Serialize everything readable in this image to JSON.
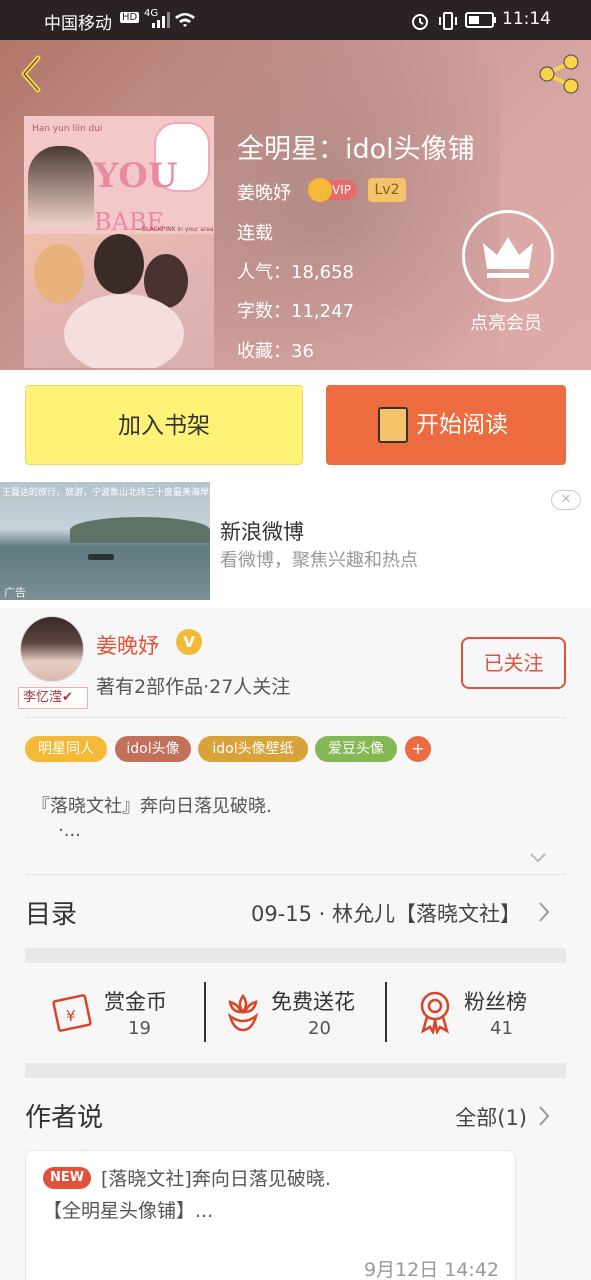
{
  "status_bar": {
    "carrier": "中国移动",
    "network": "4G",
    "time": "11:14"
  },
  "book": {
    "title": "全明星：idol头像铺",
    "author": "姜晚妤",
    "vip_label": "VIP",
    "level": "Lv2",
    "status": "连载",
    "popularity": "人气：18,658",
    "word_count": "字数：11,247",
    "favorites": "收藏：36",
    "cover_text": {
      "top": "Han yun liin dui",
      "you": "YOU",
      "babe": "BABE",
      "tagline": "—BLACKPINK in your area"
    }
  },
  "member": {
    "label": "点亮会员"
  },
  "actions": {
    "add_shelf": "加入书架",
    "start_read": "开始阅读"
  },
  "ad": {
    "caption": "王曼达的旅行，旅游，宁波象山北纬三十度最美海岸线，这",
    "title": "新浪微博",
    "subtitle": "看微博，聚焦兴趣和热点",
    "ad_label": "广告",
    "close": "✕"
  },
  "author_card": {
    "name": "姜晚妤",
    "verified": "V",
    "stats": "著有2部作品·27人关注",
    "avatar_tag": "李忆滢✔",
    "follow_label": "已关注"
  },
  "tags": [
    {
      "label": "明星同人",
      "color": "#f5b938"
    },
    {
      "label": "idol头像",
      "color": "#c2705a"
    },
    {
      "label": "idol头像壁纸",
      "color": "#d8a33a"
    },
    {
      "label": "爱豆头像",
      "color": "#85b855"
    }
  ],
  "tag_add": "+",
  "description": {
    "line1": "『落晓文社』奔向日落见破晓.",
    "line2": "·..."
  },
  "toc": {
    "label": "目录",
    "latest": "09-15 · 林允儿【落晓文社】"
  },
  "stats": [
    {
      "label": "赏金币",
      "value": "19",
      "icon": "red-envelope-icon"
    },
    {
      "label": "免费送花",
      "value": "20",
      "icon": "flower-icon"
    },
    {
      "label": "粉丝榜",
      "value": "41",
      "icon": "medal-icon"
    }
  ],
  "author_says": {
    "label": "作者说",
    "all": "全部(1)",
    "post": {
      "badge": "NEW",
      "line1": "[落晓文社]奔向日落见破晓.",
      "line2": "【全明星头像铺】...",
      "date": "9月12日  14:42"
    }
  },
  "colors": {
    "accent": "#ec6b3f",
    "shelf_button": "#fef277",
    "author_name": "#e0533a"
  }
}
